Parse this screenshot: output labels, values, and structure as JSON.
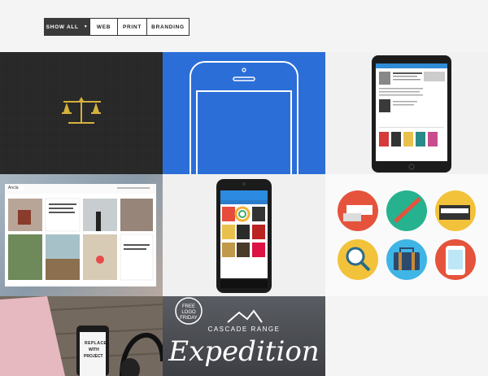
{
  "filters": {
    "show_all": "SHOW ALL",
    "web": "WEB",
    "print": "PRINT",
    "branding": "BRANDING"
  },
  "tiles": {
    "anchor_blog_text": "Ancla",
    "poster_small": "FREE LOGO FRIDAY",
    "cascade_range": "CASCADE RANGE",
    "expedition": "Expedition",
    "replace": "REPLACE",
    "with": "WITH",
    "project": "PROJECT"
  },
  "icons": [
    "scales-logo-icon",
    "smartphone-outline-icon",
    "tablet-icon",
    "android-phone-icon",
    "flat-icons-set"
  ],
  "colors": {
    "active_filter_bg": "#3a3a3a",
    "blue_tile": "#2b6ed8",
    "gold": "#d4b13d"
  }
}
